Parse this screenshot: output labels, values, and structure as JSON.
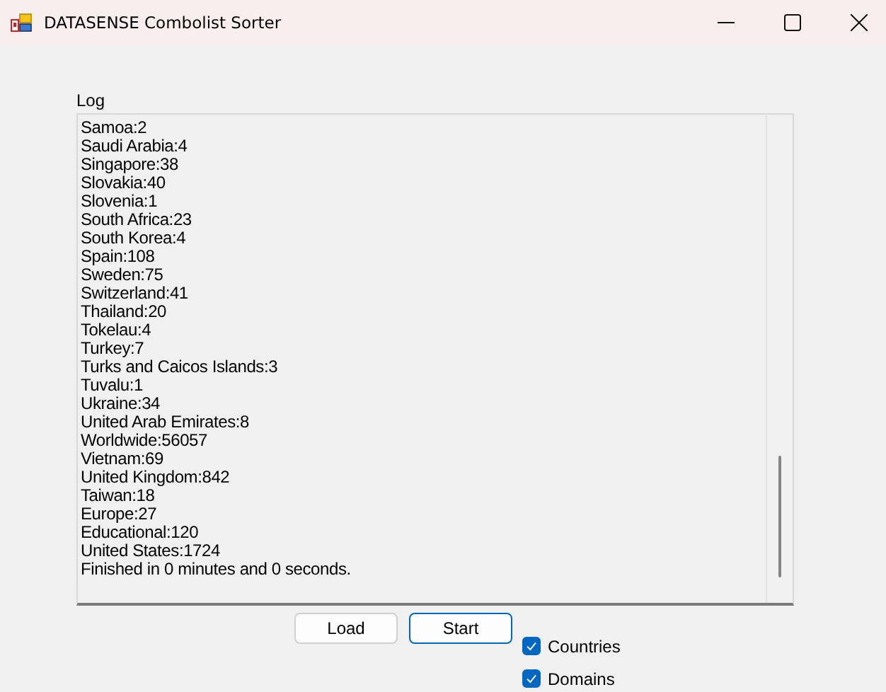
{
  "window": {
    "title": "DATASENSE Combolist Sorter"
  },
  "log": {
    "label": "Log",
    "lines": [
      "Samoa:2",
      "Saudi Arabia:4",
      "Singapore:38",
      "Slovakia:40",
      "Slovenia:1",
      "South Africa:23",
      "South Korea:4",
      "Spain:108",
      "Sweden:75",
      "Switzerland:41",
      "Thailand:20",
      "Tokelau:4",
      "Turkey:7",
      "Turks and Caicos Islands:3",
      "Tuvalu:1",
      "Ukraine:34",
      "United Arab Emirates:8",
      "Worldwide:56057",
      "Vietnam:69",
      "United Kingdom:842",
      "Taiwan:18",
      "Europe:27",
      "Educational:120",
      "United States:1724",
      "Finished in 0 minutes and 0 seconds."
    ]
  },
  "buttons": [
    {
      "label": "Load",
      "focused": false
    },
    {
      "label": "Start",
      "focused": true
    }
  ],
  "checkboxes": [
    {
      "label": "Countries",
      "checked": true
    },
    {
      "label": "Domains",
      "checked": true
    }
  ]
}
